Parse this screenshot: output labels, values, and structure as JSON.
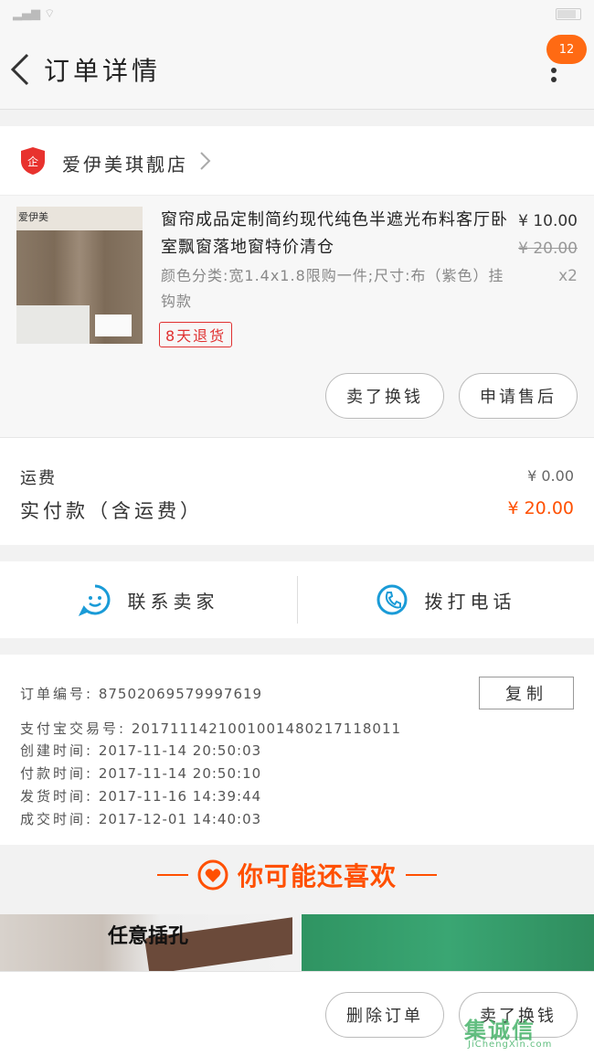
{
  "header": {
    "title": "订单详情",
    "badge_count": "12"
  },
  "shop": {
    "logo_text": "企",
    "name": "爱伊美琪靓店"
  },
  "item": {
    "image_brand": "爱伊美",
    "name": "窗帘成品定制简约现代纯色半遮光布料客厅卧室飘窗落地窗特价清仓",
    "sku": "颜色分类:宽1.4x1.8限购一件;尺寸:布（紫色）挂钩款",
    "tag": "8天退货",
    "price": "¥ 10.00",
    "original_price": "¥ 20.00",
    "quantity": "x2",
    "buttons": [
      "卖了换钱",
      "申请售后"
    ]
  },
  "fee": {
    "shipping_label": "运费",
    "shipping_value": "¥ 0.00",
    "paid_label": "实付款（含运费）",
    "paid_value": "¥ 20.00"
  },
  "contact": {
    "seller_label": "联系卖家",
    "call_label": "拨打电话"
  },
  "order_info": {
    "copy_label": "复制",
    "lines": [
      {
        "key": "订单编号:",
        "value": "87502069579997619"
      },
      {
        "key": "支付宝交易号:",
        "value": "2017111421001001480217118011"
      },
      {
        "key": "创建时间:",
        "value": "2017-11-14 20:50:03"
      },
      {
        "key": "付款时间:",
        "value": "2017-11-14 20:50:10"
      },
      {
        "key": "发货时间:",
        "value": "2017-11-16 14:39:44"
      },
      {
        "key": "成交时间:",
        "value": "2017-12-01 14:40:03"
      }
    ]
  },
  "recommend": {
    "title": "你可能还喜欢",
    "item1_text": "任意插孔"
  },
  "bottom": {
    "delete_label": "删除订单",
    "sell_label": "卖了换钱"
  },
  "watermark": {
    "main": "集诚信",
    "sub": "JiChengXin.com"
  },
  "colors": {
    "accent": "#ff5000",
    "badge": "#ff6a13",
    "link_blue": "#1a9bd7",
    "tag_red": "#e03030"
  },
  "icons": [
    "back-arrow-icon",
    "more-dots-icon",
    "shop-logo-icon",
    "chevron-right-icon",
    "chat-face-icon",
    "phone-icon",
    "heart-icon"
  ]
}
